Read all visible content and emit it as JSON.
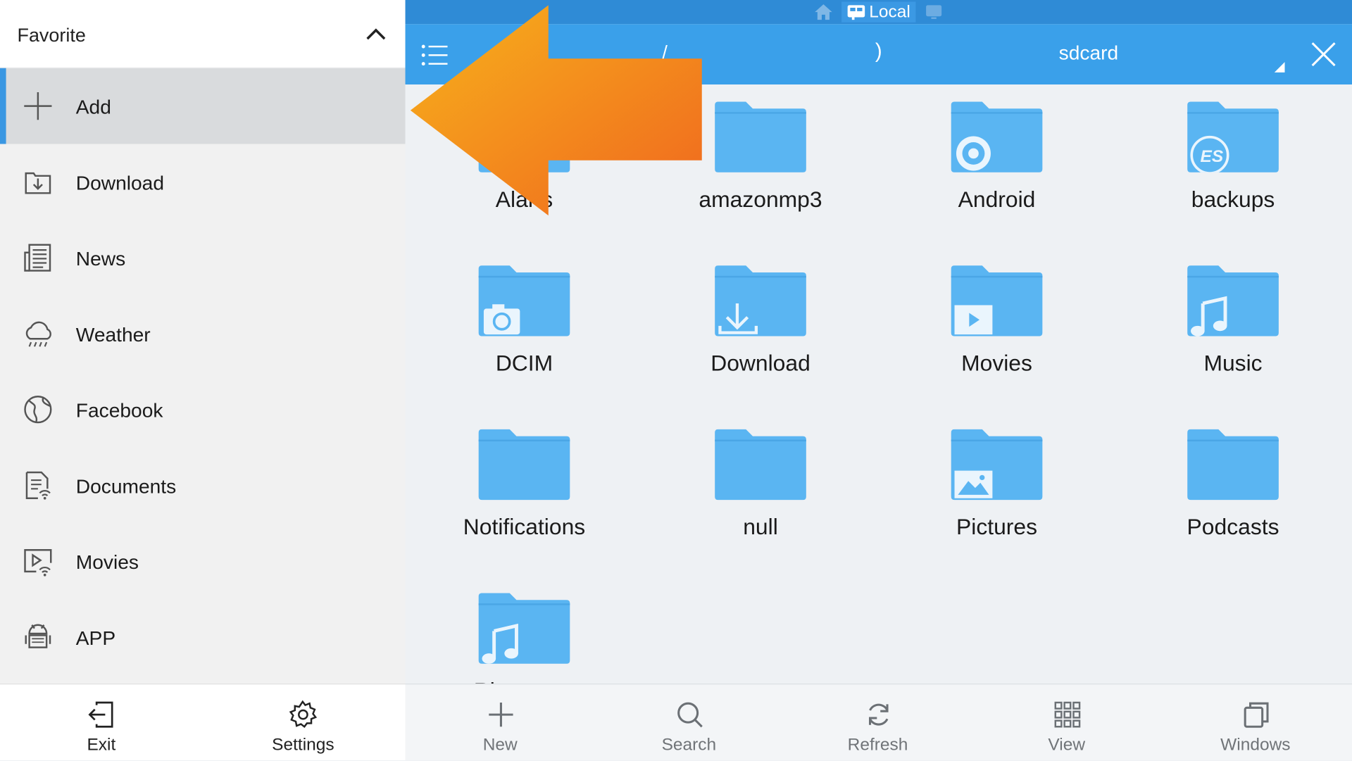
{
  "window_bar": {
    "home_icon": "home-icon",
    "local_label": "Local",
    "local_icon": "window-icon",
    "other_icon": "screen-icon"
  },
  "toolbar": {
    "crumb_root": "/",
    "crumb_separator": ")",
    "crumb_current": "sdcard",
    "menu_icon": "list-menu-icon",
    "close_icon": "close-icon"
  },
  "folders": [
    {
      "name": "Alarms",
      "glyph": "none"
    },
    {
      "name": "amazonmp3",
      "glyph": "none"
    },
    {
      "name": "Android",
      "glyph": "gear"
    },
    {
      "name": "backups",
      "glyph": "es-logo"
    },
    {
      "name": "DCIM",
      "glyph": "camera"
    },
    {
      "name": "Download",
      "glyph": "download"
    },
    {
      "name": "Movies",
      "glyph": "play"
    },
    {
      "name": "Music",
      "glyph": "note"
    },
    {
      "name": "Notifications",
      "glyph": "none"
    },
    {
      "name": "null",
      "glyph": "none"
    },
    {
      "name": "Pictures",
      "glyph": "picture"
    },
    {
      "name": "Podcasts",
      "glyph": "none"
    },
    {
      "name": "Ringtones",
      "glyph": "note"
    }
  ],
  "alarms_visible_label": "Alar  s",
  "bottom_bar": [
    {
      "label": "New",
      "icon": "plus-icon"
    },
    {
      "label": "Search",
      "icon": "search-icon"
    },
    {
      "label": "Refresh",
      "icon": "refresh-icon"
    },
    {
      "label": "View",
      "icon": "grid-view-icon"
    },
    {
      "label": "Windows",
      "icon": "windows-icon"
    }
  ],
  "drawer": {
    "title": "Favorite",
    "items": [
      {
        "label": "Add",
        "icon": "plus-icon",
        "active": true
      },
      {
        "label": "Download",
        "icon": "download-icon"
      },
      {
        "label": "News",
        "icon": "news-icon"
      },
      {
        "label": "Weather",
        "icon": "weather-icon"
      },
      {
        "label": "Facebook",
        "icon": "globe-icon"
      },
      {
        "label": "Documents",
        "icon": "documents-icon"
      },
      {
        "label": "Movies",
        "icon": "movies-icon"
      },
      {
        "label": "APP",
        "icon": "android-icon"
      }
    ],
    "exit_label": "Exit",
    "settings_label": "Settings"
  },
  "colors": {
    "accent": "#3aa0ea",
    "folder": "#5ab5f2",
    "arrow": "#f5921e",
    "selected_bar": "#3a97e2"
  }
}
